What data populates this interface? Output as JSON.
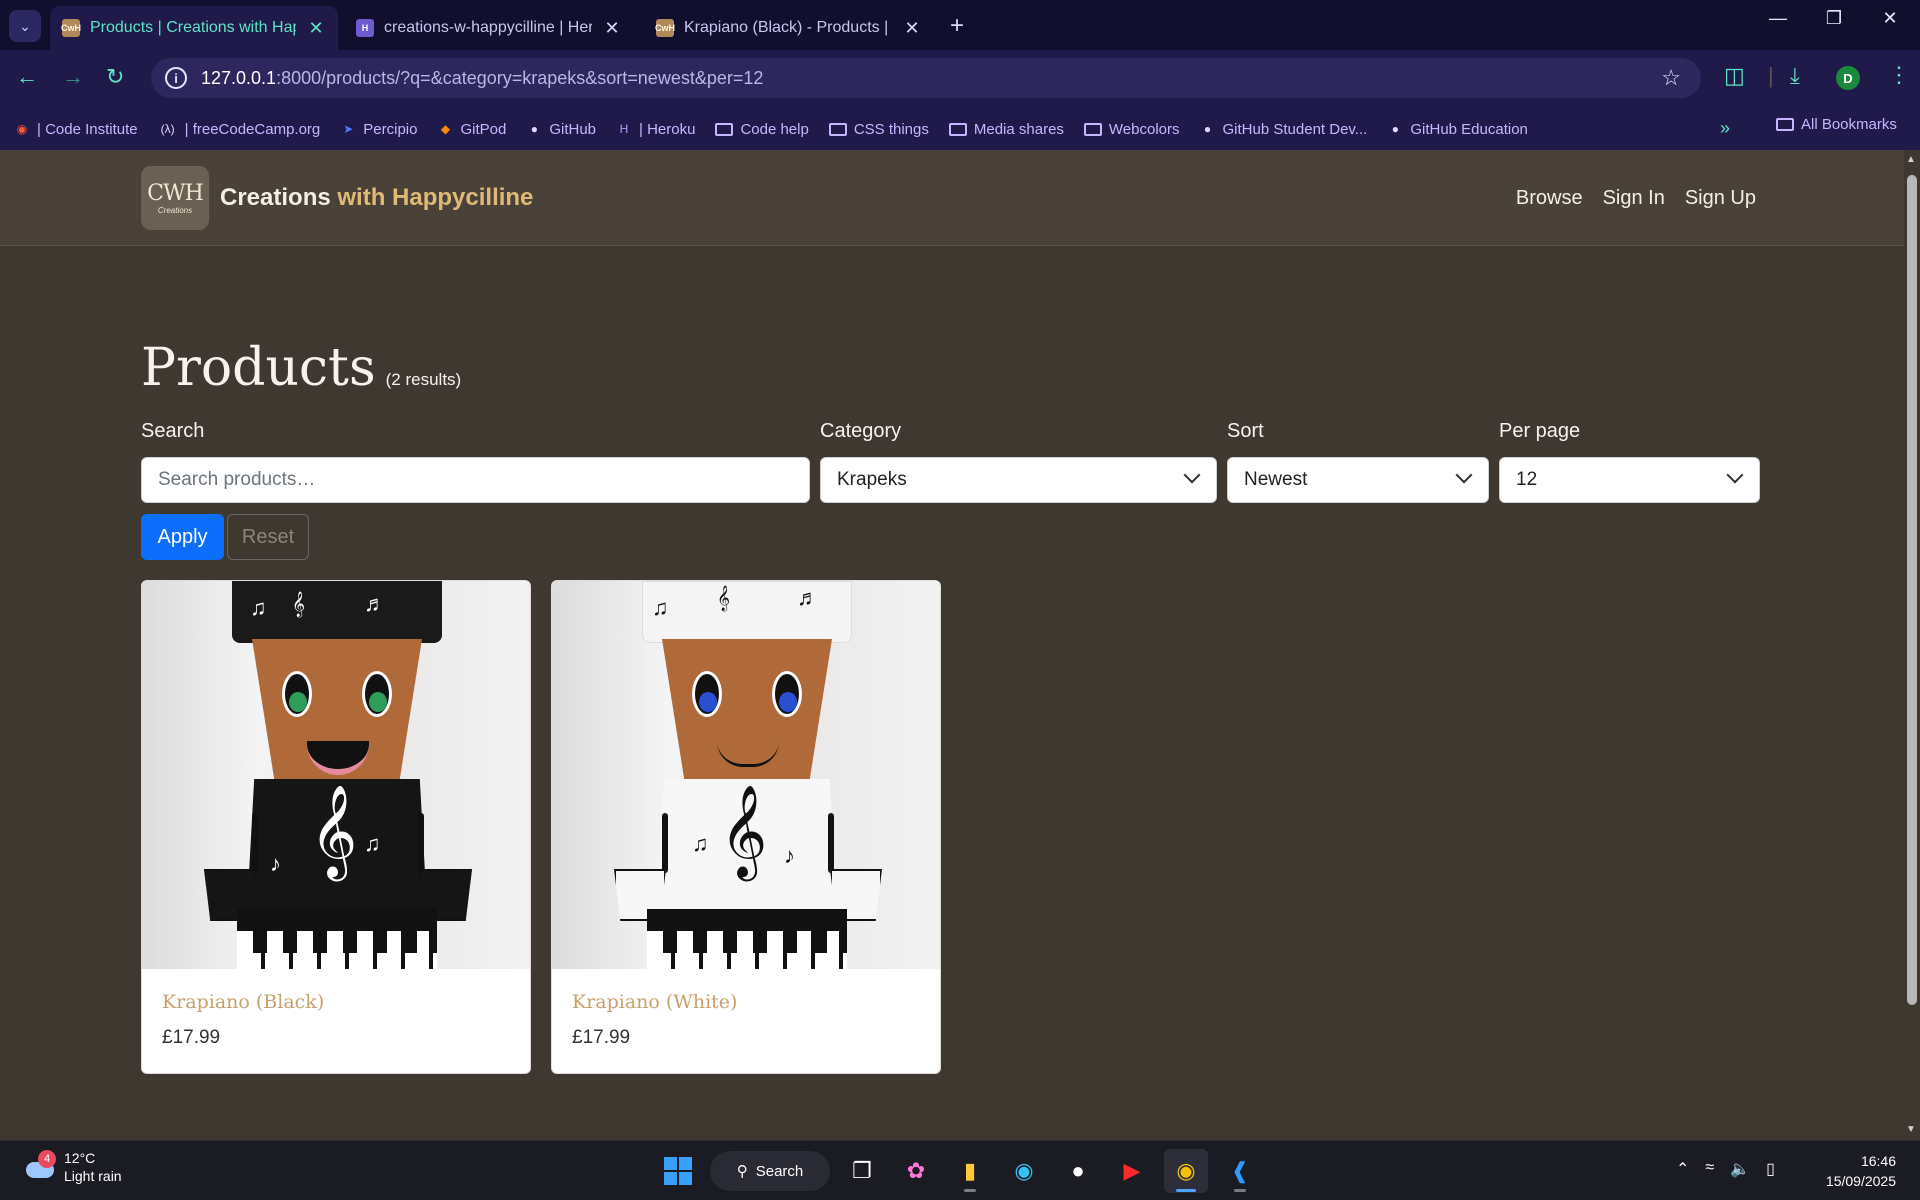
{
  "browser": {
    "tabs": [
      {
        "title": "Products | Creations with Happycilline",
        "favicon": "cwh-logo-icon",
        "active": true
      },
      {
        "title": "creations-w-happycilline | Heroku",
        "favicon": "heroku-icon",
        "active": false
      },
      {
        "title": "Krapiano (Black) - Products | Creations",
        "favicon": "cwh-logo-icon",
        "active": false
      }
    ],
    "url_host": "127.0.0.1",
    "url_rest": ":8000/products/?q=&category=krapeks&sort=newest&per=12",
    "profile_initial": "D",
    "bookmarks": [
      {
        "label": "| Code Institute",
        "icon": "code-institute-icon"
      },
      {
        "label": "| freeCodeCamp.org",
        "icon": "freecodecamp-icon"
      },
      {
        "label": "Percipio",
        "icon": "percipio-icon"
      },
      {
        "label": "GitPod",
        "icon": "gitpod-icon"
      },
      {
        "label": "GitHub",
        "icon": "github-icon"
      },
      {
        "label": "| Heroku",
        "icon": "heroku-icon"
      },
      {
        "label": "Code help",
        "icon": "folder-icon"
      },
      {
        "label": "CSS things",
        "icon": "folder-icon"
      },
      {
        "label": "Media shares",
        "icon": "folder-icon"
      },
      {
        "label": "Webcolors",
        "icon": "folder-icon"
      },
      {
        "label": "GitHub Student Dev...",
        "icon": "github-icon"
      },
      {
        "label": "GitHub Education",
        "icon": "github-icon"
      }
    ],
    "all_bookmarks": "All Bookmarks"
  },
  "site": {
    "logo_text": "CWH",
    "logo_subtext": "Creations",
    "brand_main": "Creations",
    "brand_accent": "with Happycilline",
    "nav": [
      "Browse",
      "Sign In",
      "Sign Up"
    ]
  },
  "products_page": {
    "title": "Products",
    "results": "(2 results)",
    "filters": {
      "search_label": "Search",
      "search_placeholder": "Search products…",
      "category_label": "Category",
      "category_value": "Krapeks",
      "sort_label": "Sort",
      "sort_value": "Newest",
      "per_page_label": "Per page",
      "per_page_value": "12",
      "apply": "Apply",
      "reset": "Reset"
    },
    "products": [
      {
        "name": "Krapiano (Black)",
        "price": "£17.99",
        "variant": "black"
      },
      {
        "name": "Krapiano (White)",
        "price": "£17.99",
        "variant": "white"
      }
    ]
  },
  "taskbar": {
    "weather_temp": "12°C",
    "weather_desc": "Light rain",
    "weather_badge": "4",
    "search": "Search",
    "time": "16:46",
    "date": "15/09/2025"
  },
  "colors": {
    "page_bg": "#3e3830",
    "accent_gold": "#e0b976",
    "primary_button": "#0d6efd"
  }
}
